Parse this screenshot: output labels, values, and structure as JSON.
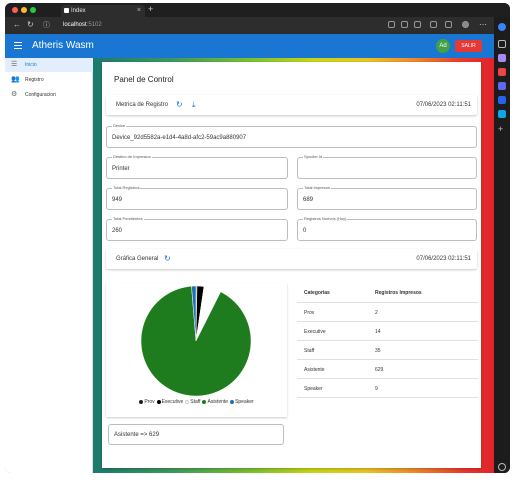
{
  "browser": {
    "tab_title": "Index",
    "tab_close": "×",
    "new_tab": "+",
    "url_host": "localhost",
    "url_port": ":5102"
  },
  "app": {
    "title": "Atheris Wasm",
    "avatar_text": "Ad",
    "logout_label": "SALIR"
  },
  "sidebar": {
    "items": [
      {
        "label": "Inicio",
        "icon": "menu-icon",
        "active": true
      },
      {
        "label": "Registro",
        "icon": "people-icon",
        "active": false
      },
      {
        "label": "Configuracion",
        "icon": "gear-icon",
        "active": false
      }
    ]
  },
  "panel": {
    "title": "Panel de Control",
    "metrics_label": "Metrica de Registro",
    "metrics_timestamp": "07/06/2023 02:11:51",
    "fields": {
      "device_label": "Device",
      "device_value": "Device_92d5582a-e1d4-4a8d-afc2-59ac9a880907",
      "printer_label": "Destino de Impresion",
      "printer_value": "Printer",
      "spooler_label": "Spooler Id",
      "spooler_value": "",
      "total_label": "Total Registros",
      "total_value": "949",
      "printed_label": "Total Impresos",
      "printed_value": "689",
      "pending_label": "Total Pendientes",
      "pending_value": "260",
      "new_label": "Registros Nuevos (Hoy)",
      "new_value": "0"
    },
    "chart_label": "Gráfica General",
    "chart_timestamp": "07/06/2023 02:11:51",
    "selected_slice": "Asistente => 629"
  },
  "table": {
    "headers": [
      "Categorias",
      "Registros Impresos"
    ],
    "rows": [
      [
        "Prov",
        "2"
      ],
      [
        "Executive",
        "14"
      ],
      [
        "Staff",
        "35"
      ],
      [
        "Asistente",
        "629"
      ],
      [
        "Speaker",
        "9"
      ]
    ]
  },
  "chart_data": {
    "type": "pie",
    "categories": [
      "Prov",
      "Executive",
      "Staff",
      "Asistente",
      "Speaker"
    ],
    "values": [
      2,
      14,
      35,
      629,
      9
    ],
    "colors": [
      "#212121",
      "#000000",
      "#ffffff",
      "#1e7b1e",
      "#1f6fb2"
    ],
    "legend": "bottom"
  }
}
